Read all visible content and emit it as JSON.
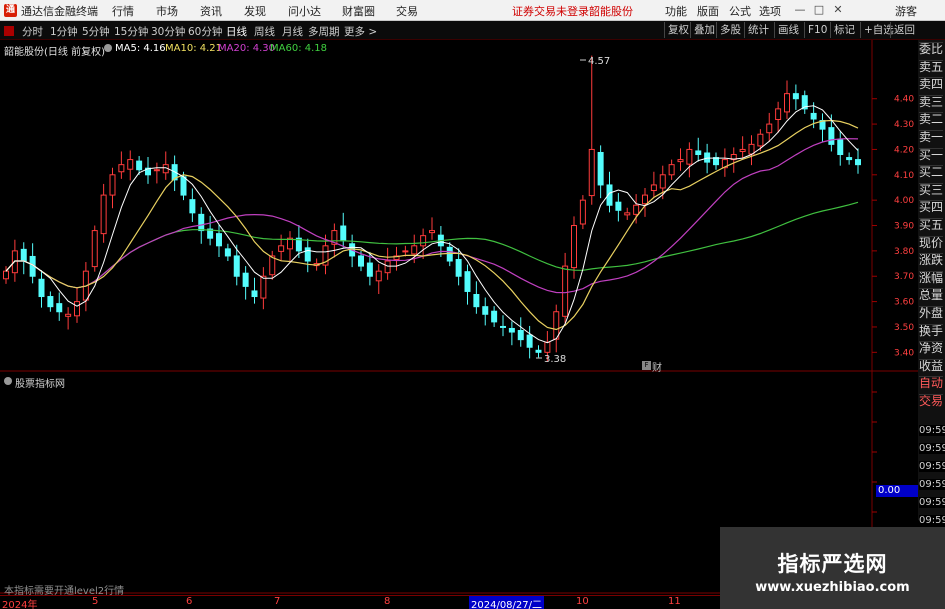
{
  "app": {
    "logo_glyph": "通",
    "title": "通达信金融终端",
    "guest": "游客"
  },
  "menu": [
    "行情",
    "市场",
    "资讯",
    "发现",
    "问小达",
    "财富圈",
    "交易"
  ],
  "notice": {
    "text": "证券交易未登录",
    "stock": "韶能股份"
  },
  "menu_right": [
    "功能",
    "版面",
    "公式",
    "选项"
  ],
  "window_controls": [
    "minimize-icon",
    "maximize-icon",
    "close-icon"
  ],
  "timeframes": [
    "分时",
    "1分钟",
    "5分钟",
    "15分钟",
    "30分钟",
    "60分钟",
    "日线",
    "周线",
    "月线",
    "多周期",
    "更多 >"
  ],
  "active_timeframe": "日线",
  "right_tools": [
    "复权",
    "叠加",
    "多股",
    "统计",
    "画线",
    "F10",
    "标记",
    "+自选",
    "返回"
  ],
  "stock_header": "韶能股份(日线 前复权)",
  "ma_labels": [
    {
      "label": "MA5: 4.16",
      "color": "#ffffff"
    },
    {
      "label": "MA10: 4.21",
      "color": "#f0e060"
    },
    {
      "label": "MA20: 4.30",
      "color": "#d040d0"
    },
    {
      "label": "MA60: 4.18",
      "color": "#40d040"
    }
  ],
  "high_label": "4.57",
  "low_label": "3.38",
  "finance_badge": "财",
  "indicator": {
    "title": "股票指标网",
    "value": "0.00",
    "notice": "本指标需要开通level2行情"
  },
  "side_labels": [
    "委比",
    "卖五",
    "卖四",
    "卖三",
    "卖二",
    "卖一",
    "买一",
    "买二",
    "买三",
    "买四",
    "买五",
    "现价",
    "涨跌",
    "涨幅",
    "总量",
    "外盘",
    "换手",
    "净资",
    "收益",
    "自动",
    "交易"
  ],
  "side_times": [
    "09:59",
    "09:59",
    "09:59",
    "09:59",
    "09:59",
    "09:59"
  ],
  "x_axis": [
    "2024年",
    "5",
    "6",
    "7",
    "8",
    "2024/08/27/二",
    "10",
    "11"
  ],
  "watermark": {
    "title": "指标严选网",
    "url": "www.xuezhibiao.com"
  },
  "chart_data": {
    "type": "candlestick",
    "y_ticks": [
      4.4,
      4.3,
      4.2,
      4.1,
      4.0,
      3.9,
      3.8,
      3.7,
      3.6,
      3.5,
      3.4
    ],
    "ylim": [
      3.35,
      4.6
    ],
    "high": 4.57,
    "low": 3.38,
    "closes": [
      3.72,
      3.8,
      3.76,
      3.7,
      3.62,
      3.58,
      3.56,
      3.55,
      3.6,
      3.72,
      3.88,
      4.02,
      4.1,
      4.14,
      4.16,
      4.12,
      4.1,
      4.12,
      4.14,
      4.08,
      4.02,
      3.95,
      3.88,
      3.85,
      3.82,
      3.78,
      3.7,
      3.66,
      3.62,
      3.7,
      3.78,
      3.82,
      3.85,
      3.8,
      3.76,
      3.75,
      3.82,
      3.88,
      3.84,
      3.78,
      3.74,
      3.7,
      3.72,
      3.76,
      3.78,
      3.8,
      3.82,
      3.86,
      3.88,
      3.82,
      3.76,
      3.7,
      3.64,
      3.58,
      3.55,
      3.52,
      3.5,
      3.48,
      3.45,
      3.42,
      3.4,
      3.44,
      3.56,
      3.74,
      3.9,
      4.0,
      4.2,
      4.06,
      3.98,
      3.96,
      3.95,
      3.98,
      4.02,
      4.06,
      4.1,
      4.14,
      4.16,
      4.2,
      4.18,
      4.15,
      4.14,
      4.16,
      4.18,
      4.2,
      4.22,
      4.26,
      4.3,
      4.36,
      4.42,
      4.4,
      4.36,
      4.32,
      4.28,
      4.22,
      4.18,
      4.16,
      4.14
    ],
    "ma5": 4.16,
    "ma10": 4.21,
    "ma20": 4.3,
    "ma60": 4.18,
    "indicator_value": 0.0
  }
}
